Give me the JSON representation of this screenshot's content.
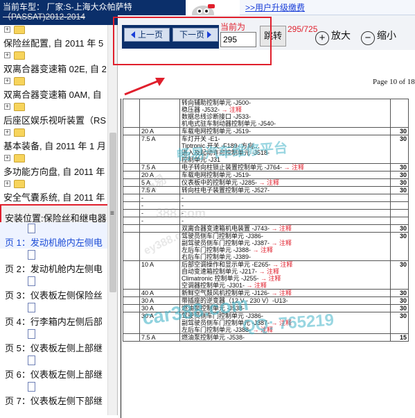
{
  "header": {
    "car_model_line1": "当前车型： 厂家:S-上海大众帕萨特",
    "car_model_line2": "（PASSAT)2012-2014",
    "upgrade_link": ">>用户升级缴费"
  },
  "tree": {
    "items": [
      {
        "label": "保险丝配置, 自 2011 年 5"
      },
      {
        "label": "双离合器变速箱 02E, 自 2"
      },
      {
        "label": "双离合器变速箱 0AM, 自"
      },
      {
        "label": "后座区娱乐视听装置（RS"
      },
      {
        "label": "基本装备, 自 2011 年 1 月"
      },
      {
        "label": "多功能方向盘, 自 2011 年"
      },
      {
        "label": "安全气囊系统, 自 2011 年"
      }
    ],
    "selected_label": "安装位置:保险丝和继电器",
    "pages": [
      {
        "label": "页 1：发动机舱内左侧电"
      },
      {
        "label": "页 2：发动机舱内左侧电"
      },
      {
        "label": "页 3：仪表板左侧保险丝"
      },
      {
        "label": "页 4：行李箱内左侧后部"
      },
      {
        "label": "页 5：仪表板左侧上部继"
      },
      {
        "label": "页 6：仪表板左侧上部继"
      },
      {
        "label": "页 7：仪表板左侧下部继"
      }
    ]
  },
  "toolbar": {
    "prev_label": "上一页",
    "next_label": "下一页",
    "current_label": "当前为",
    "page_value": "295",
    "jump_label": "跳转",
    "page_count": "295/725",
    "zoom_in_label": "放大",
    "zoom_out_label": "缩小"
  },
  "document": {
    "page_of": "Page 10 of 18",
    "rows": [
      {
        "pos": "",
        "amp": "",
        "desc": [
          {
            "t": "转向辅助控制单元 -J500-"
          },
          {
            "t": "稳压器 -J532- ",
            "n": "→ 注释"
          },
          {
            "t": "数据总线诊断接口 -J533-"
          },
          {
            "t": "机电式驻车制动器控制单元 -J540-"
          }
        ],
        "val": ""
      },
      {
        "pos": "",
        "amp": "20 A",
        "desc": [
          {
            "t": "车载电网控制单元 -J519-"
          }
        ],
        "val": "30"
      },
      {
        "pos": "",
        "amp": "7.5 A",
        "desc": [
          {
            "t": "车灯开关 -E1-"
          },
          {
            "t": "Tiptronic 开关 -F189- 方向…"
          },
          {
            "t": "进入及起动许可控制单元 -J518- "
          },
          {
            "t": "控制单元 -J31"
          }
        ],
        "val": "30"
      },
      {
        "pos": "",
        "amp": "7.5 A",
        "desc": [
          {
            "t": "电子转向柱锁止装置控制单元 -J764- ",
            "n": "→ 注释"
          }
        ],
        "val": "30"
      },
      {
        "pos": "",
        "amp": "20 A",
        "desc": [
          {
            "t": "车载电网控制单元 -J519-"
          }
        ],
        "val": "30"
      },
      {
        "pos": "",
        "amp": "5 A",
        "desc": [
          {
            "t": "仪表板中的控制单元 -J285- ",
            "n": "→ 注释"
          }
        ],
        "val": "30"
      },
      {
        "pos": "",
        "amp": "7.5 A",
        "desc": [
          {
            "t": "转向柱电子装置控制单元 -J527-"
          }
        ],
        "val": "30"
      },
      {
        "pos": "",
        "amp": "-",
        "desc": [
          {
            "t": "-"
          }
        ],
        "val": ""
      },
      {
        "pos": "",
        "amp": "-",
        "desc": [
          {
            "t": "-"
          }
        ],
        "val": ""
      },
      {
        "pos": "",
        "amp": "-",
        "desc": [
          {
            "t": "-"
          }
        ],
        "val": ""
      },
      {
        "pos": "",
        "amp": "-",
        "desc": [
          {
            "t": "-"
          }
        ],
        "val": ""
      },
      {
        "pos": "",
        "amp": "",
        "desc": [
          {
            "t": "双离合器变速箱机电装置 -J743- ",
            "n": "→ 注释"
          }
        ],
        "val": "30"
      },
      {
        "pos": "",
        "amp": "",
        "desc": [
          {
            "t": "驾驶员侧车门控制单元 -J386-"
          },
          {
            "t": "副驾驶员侧车门控制单元 -J387- ",
            "n": "→ 注释"
          },
          {
            "t": "左后车门控制单元 -J388- ",
            "n": "→ 注释"
          },
          {
            "t": "右后车门控制单元 -J389-"
          }
        ],
        "val": "30"
      },
      {
        "pos": "",
        "amp": "10 A",
        "desc": [
          {
            "t": "后部空调操作和显示单元 -E265- ",
            "n": "→ 注释"
          },
          {
            "t": "自动变速箱控制单元 -J217- ",
            "n": "→ 注释"
          },
          {
            "t": "Climatronic 控制单元 -J255- ",
            "n": "→ 注释"
          },
          {
            "t": "空调器控制单元 -J301- ",
            "n": "→ 注释"
          }
        ],
        "val": "30"
      },
      {
        "pos": "",
        "amp": "40 A",
        "desc": [
          {
            "t": "新鲜空气鼓风机控制单元 -J126- ",
            "n": "→ 注释"
          }
        ],
        "val": "30"
      },
      {
        "pos": "",
        "amp": "30 A",
        "desc": [
          {
            "t": "带插座的逆变器（12 V - 230 V）-U13-"
          }
        ],
        "val": "30"
      },
      {
        "pos": "",
        "amp": "30 A",
        "desc": [
          {
            "t": "燃油泵控制单元 -J538-"
          }
        ],
        "val": "30"
      },
      {
        "pos": "",
        "amp": "30 A",
        "desc": [
          {
            "t": "驾驶员侧车门控制单元 -J386-"
          },
          {
            "t": "副驾驶员侧车门控制单元 -J387- ",
            "n": "→ 注释"
          },
          {
            "t": "左后车门控制单元 -J388- ",
            "n": "→ 注释"
          }
        ],
        "val": "30"
      },
      {
        "pos": "",
        "amp": "7.5 A",
        "desc": [
          {
            "t": "燃油泵控制单元 -J538-"
          }
        ],
        "val": "15"
      }
    ],
    "watermark": [
      "畅易汽车维修平台",
      "畅易",
      "388.com",
      "ey388.com",
      "car388.com",
      "QQ: 765219"
    ]
  },
  "colors": {
    "accent": "#0b2f6a",
    "highlight": "#e01f2c",
    "link": "#1a3fd8"
  }
}
